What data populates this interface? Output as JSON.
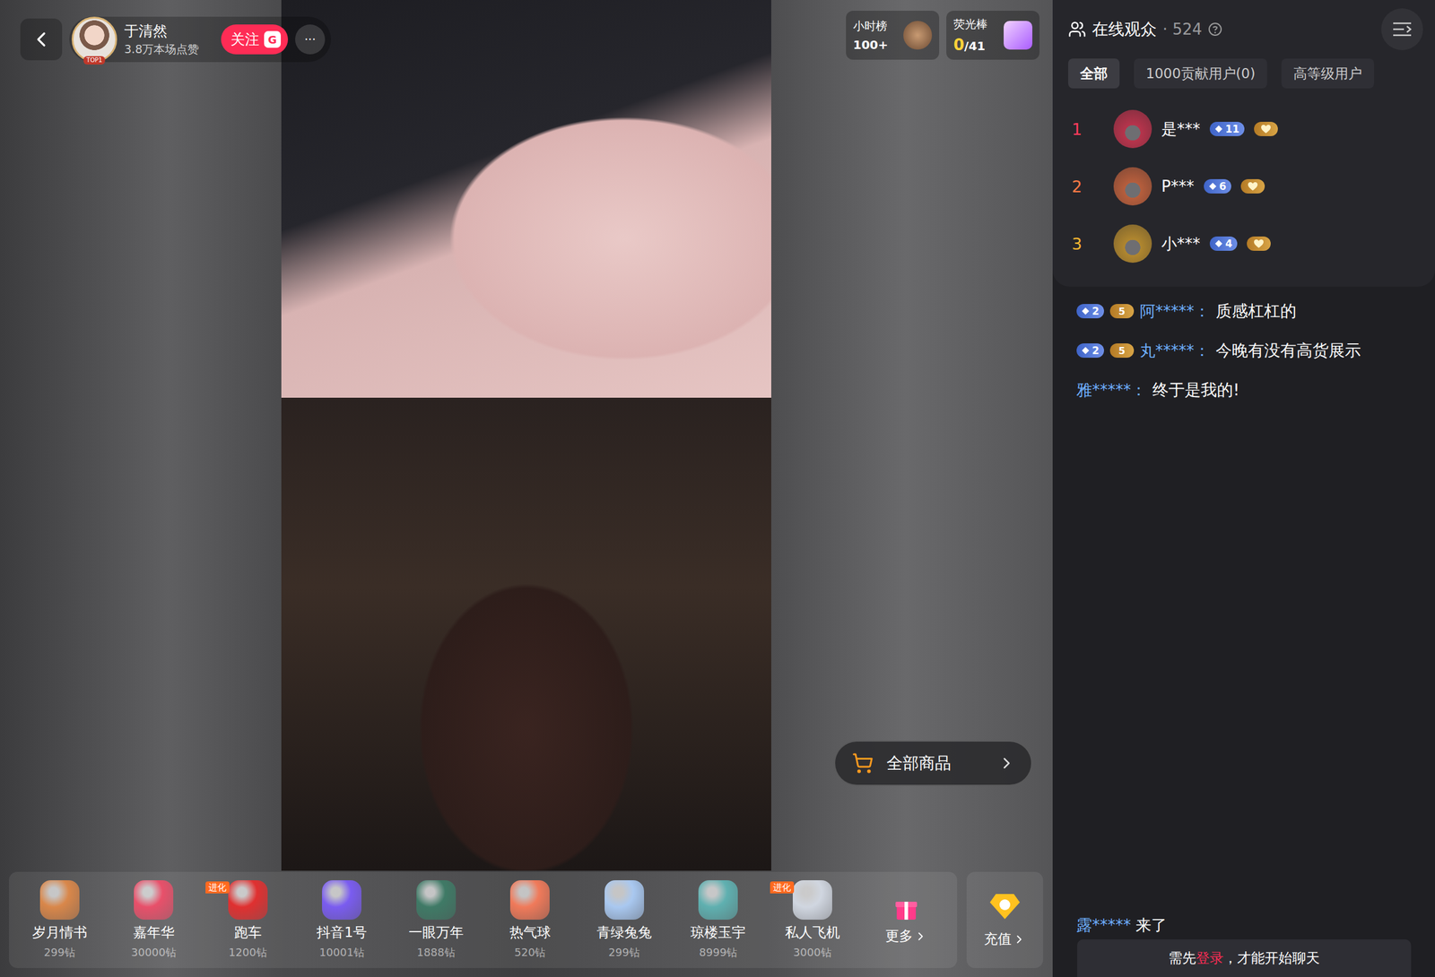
{
  "streamer": {
    "name": "于清然",
    "likes": "3.8万本场点赞",
    "avatar_badge": "TOP1",
    "follow": "关注",
    "follow_badge": "G",
    "more": "···"
  },
  "rankings": [
    {
      "label": "小时榜",
      "value": "100+",
      "highlight": "",
      "kind": "hourly"
    },
    {
      "label": "荧光棒",
      "value": "/41",
      "highlight": "0",
      "kind": "glowstick"
    }
  ],
  "goods_button": {
    "label": "全部商品"
  },
  "gifts": [
    {
      "name": "岁月情书",
      "price": "299钻",
      "badge": null,
      "color": "#d9874a"
    },
    {
      "name": "嘉年华",
      "price": "30000钻",
      "badge": null,
      "color": "#e8506a"
    },
    {
      "name": "跑车",
      "price": "1200钻",
      "badge": "进化",
      "color": "#e03030"
    },
    {
      "name": "抖音1号",
      "price": "10001钻",
      "badge": null,
      "color": "#7a5cf0"
    },
    {
      "name": "一眼万年",
      "price": "1888钻",
      "badge": null,
      "color": "#3f7a66"
    },
    {
      "name": "热气球",
      "price": "520钻",
      "badge": null,
      "color": "#f07a5a"
    },
    {
      "name": "青绿兔兔",
      "price": "299钻",
      "badge": null,
      "color": "#a9c8f0"
    },
    {
      "name": "琼楼玉宇",
      "price": "8999钻",
      "badge": null,
      "color": "#5fb0b0"
    },
    {
      "name": "私人飞机",
      "price": "3000钻",
      "badge": "进化",
      "color": "#d0d6e0"
    }
  ],
  "more": {
    "label": "更多"
  },
  "recharge": {
    "label": "充值"
  },
  "audience_panel": {
    "title": "在线观众",
    "separator": "·",
    "count": "524"
  },
  "tabs": [
    {
      "label": "全部",
      "selected": true
    },
    {
      "label": "1000贡献用户(0)",
      "selected": false
    },
    {
      "label": "高等级用户",
      "selected": false
    }
  ],
  "audience": [
    {
      "rank": "1",
      "name": "是***",
      "level": "11",
      "fan": true,
      "color": "#ff3b5c"
    },
    {
      "rank": "2",
      "name": "P***",
      "level": "6",
      "fan": true,
      "color": "#ff7a45"
    },
    {
      "rank": "3",
      "name": "小***",
      "level": "4",
      "fan": true,
      "color": "#f5b731"
    }
  ],
  "chat": [
    {
      "badges": [
        {
          "kind": "level",
          "text": "2"
        },
        {
          "kind": "fan",
          "text": "5"
        }
      ],
      "user": "阿*****：",
      "text": "质感杠杠的"
    },
    {
      "badges": [
        {
          "kind": "level",
          "text": "2"
        },
        {
          "kind": "fan",
          "text": "5"
        }
      ],
      "user": "丸*****：",
      "text": "今晚有没有高货展示"
    },
    {
      "badges": [],
      "user": "雅*****：",
      "text": "终于是我的!"
    }
  ],
  "arrival": {
    "user": "露*****",
    "text": "来了"
  },
  "login_bar": {
    "before": "需先",
    "link": "登录",
    "after": "，才能开始聊天"
  }
}
